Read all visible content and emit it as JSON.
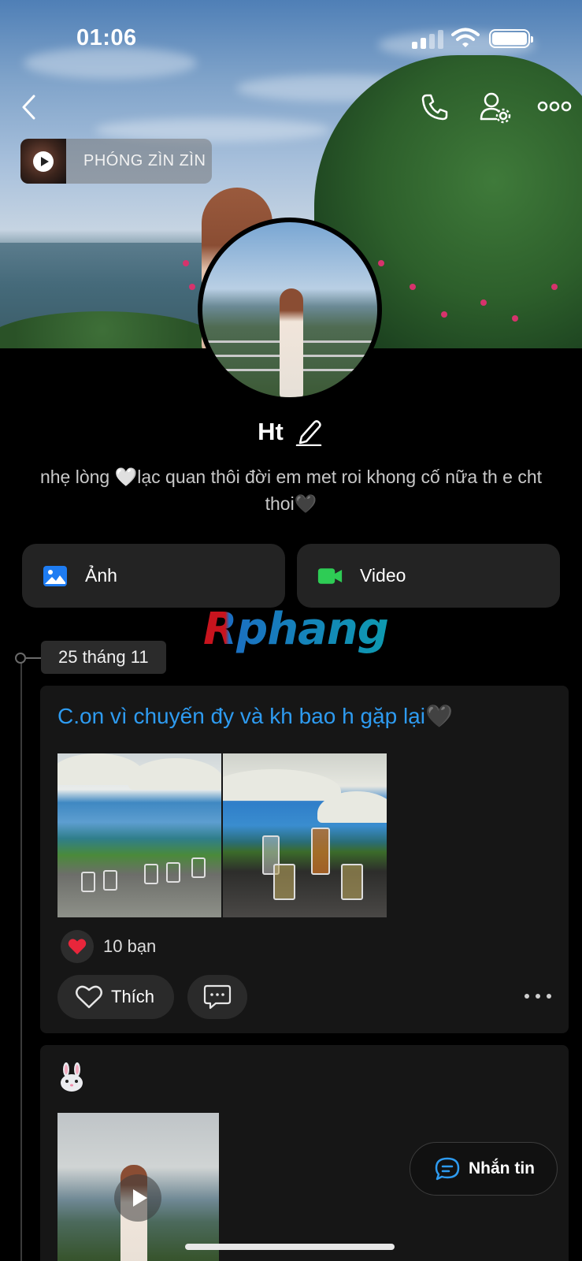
{
  "status_bar": {
    "time": "01:06"
  },
  "header": {
    "music_title": "PHÓNG ZÌN ZÌN",
    "icons": [
      "back-icon",
      "phone-icon",
      "user-settings-icon",
      "more-icon"
    ]
  },
  "profile": {
    "name": "Ht",
    "bio": "nhẹ lòng 🤍lạc quan thôi đời em met roi khong cố nữa th e cht thoi🖤"
  },
  "media_buttons": {
    "photo_label": "Ảnh",
    "video_label": "Video"
  },
  "watermark": "Rphang",
  "timeline": {
    "date": "25 tháng 11"
  },
  "posts": [
    {
      "text": "C.on vì chuyến đy và kh bao h gặp lại🖤",
      "reaction_count": "10 bạn",
      "like_label": "Thích"
    },
    {
      "emoji": "🐰"
    }
  ],
  "message_button": {
    "label": "Nhắn tin"
  },
  "colors": {
    "accent_blue": "#2e9bf0",
    "photo_icon": "#1e7cf2",
    "video_icon": "#2ecc55",
    "card_bg": "#161616",
    "button_bg": "#232323",
    "heart": "#e8263b"
  }
}
